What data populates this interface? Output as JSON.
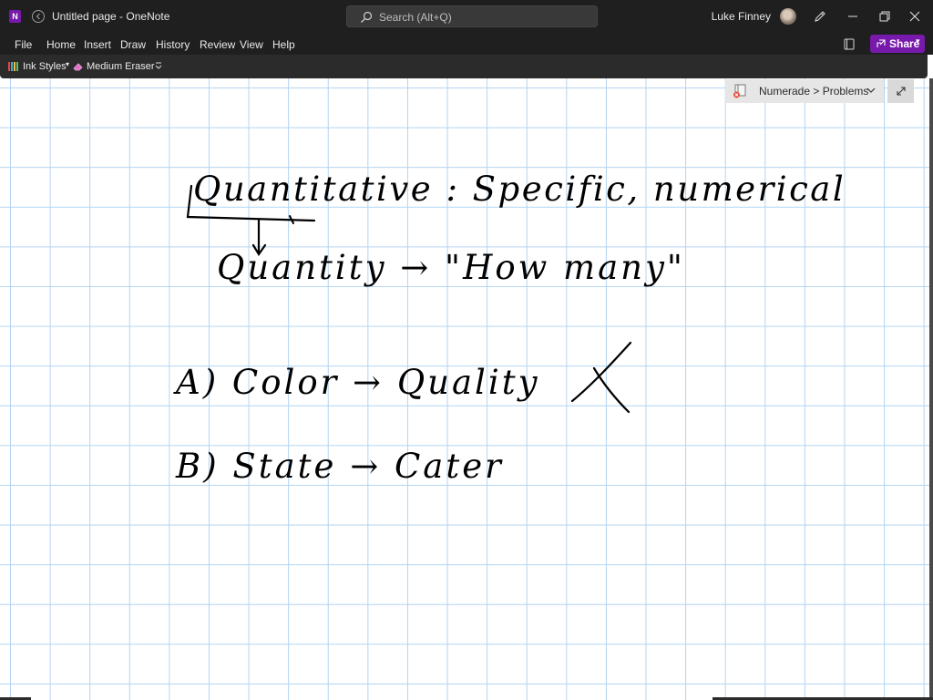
{
  "window": {
    "title": "Untitled page  -  OneNote",
    "app_logo_letter": "N",
    "user_name": "Luke Finney"
  },
  "search": {
    "placeholder": "Search (Alt+Q)"
  },
  "menu": {
    "items": [
      "File",
      "Home",
      "Insert",
      "Draw",
      "History",
      "Review",
      "View",
      "Help"
    ],
    "share_label": "Share"
  },
  "ink_toolbar": {
    "ink_styles_label": "Ink Styles",
    "eraser_label": "Medium Eraser"
  },
  "notebook": {
    "path": "Numerade > Problems"
  },
  "handwriting": {
    "line1": "Quantitative : Specific, numerical",
    "line2": "Quantity → \"How   many\"",
    "line3": "A)   Color → Quality",
    "line4": "B)   State → Cater"
  },
  "colors": {
    "titlebar_bg": "#1f1f1f",
    "accent_purple": "#7719aa",
    "grid_line": "#b3d4f2",
    "ink": "#000000"
  }
}
